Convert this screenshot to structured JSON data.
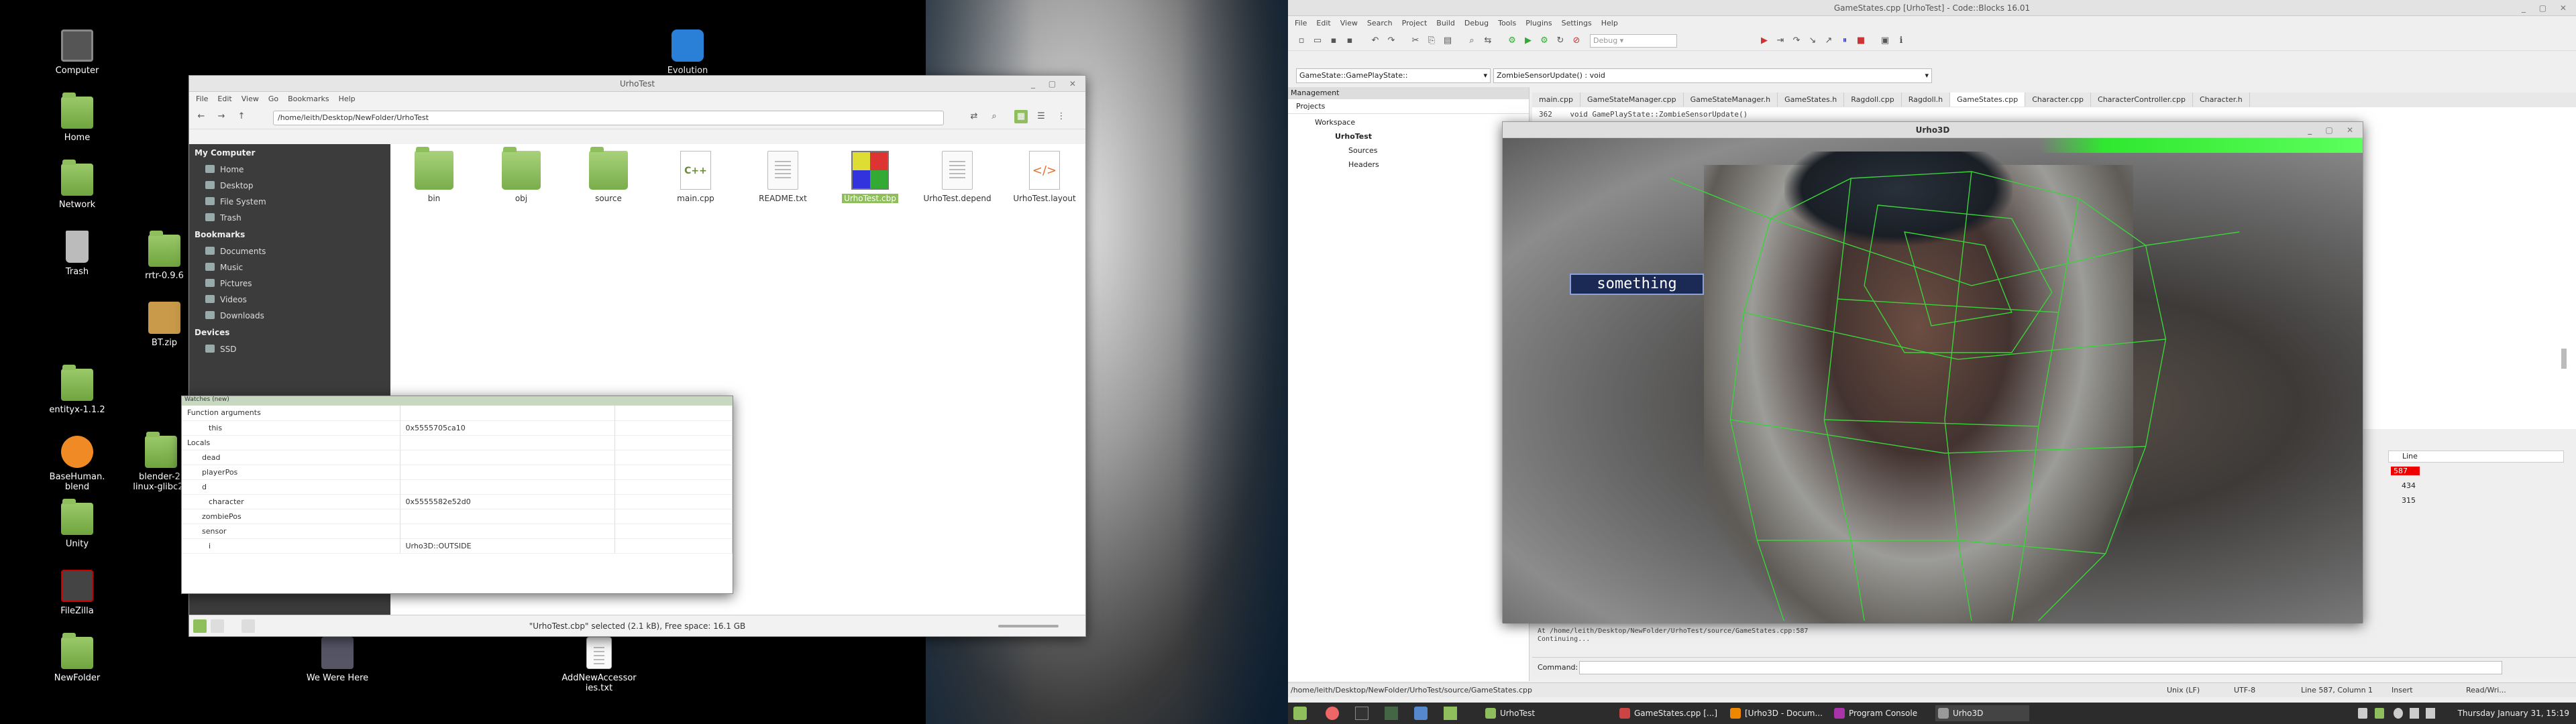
{
  "desktop": {
    "icons": [
      {
        "label": "Computer"
      },
      {
        "label": "Home"
      },
      {
        "label": "Network"
      },
      {
        "label": "Trash"
      },
      {
        "label": "rrtr-0.9.6"
      },
      {
        "label": "BT.zip"
      },
      {
        "label": "entityx-1.1.2"
      },
      {
        "label": "BaseHuman.\nblend"
      },
      {
        "label": "blender-2.\nlinux-glibc21"
      },
      {
        "label": "Unity"
      },
      {
        "label": "FileZilla"
      },
      {
        "label": "NewFolder"
      },
      {
        "label": "Evolution"
      },
      {
        "label": "We Were Here"
      },
      {
        "label": "AddNewAccessor\nies.txt"
      }
    ]
  },
  "nemo": {
    "title": "UrhoTest",
    "menu": [
      "File",
      "Edit",
      "View",
      "Go",
      "Bookmarks",
      "Help"
    ],
    "path": "/home/leith/Desktop/NewFolder/UrhoTest",
    "sidebar": {
      "computer_header": "My Computer",
      "computer_items": [
        "Home",
        "Desktop",
        "File System",
        "Trash"
      ],
      "bookmarks_header": "Bookmarks",
      "bookmark_items": [
        "Documents",
        "Music",
        "Pictures",
        "Videos",
        "Downloads"
      ],
      "devices_header": "Devices",
      "device_items": [
        "SSD"
      ]
    },
    "files": [
      "bin",
      "obj",
      "source",
      "main.cpp",
      "README.txt",
      "UrhoTest.cbp",
      "UrhoTest.depend",
      "UrhoTest.layout"
    ],
    "status": "\"UrhoTest.cbp\" selected (2.1 kB), Free space: 16.1 GB"
  },
  "watches": {
    "title": "Watches (new)",
    "rows": [
      {
        "name": "Function arguments",
        "value": ""
      },
      {
        "name": "this",
        "value": "0x5555705ca10"
      },
      {
        "name": "Locals",
        "value": ""
      },
      {
        "name": "dead",
        "value": ""
      },
      {
        "name": "playerPos",
        "value": ""
      },
      {
        "name": "d",
        "value": ""
      },
      {
        "name": "character",
        "value": "0x5555582e52d0"
      },
      {
        "name": "zombiePos",
        "value": ""
      },
      {
        "name": "sensor",
        "value": ""
      },
      {
        "name": "i",
        "value": "Urho3D::OUTSIDE"
      }
    ]
  },
  "codeblocks": {
    "title": "GameStates.cpp [UrhoTest] - Code::Blocks 16.01",
    "menu": [
      "File",
      "Edit",
      "View",
      "Search",
      "Project",
      "Build",
      "Debug",
      "Tools",
      "Plugins",
      "Settings",
      "Help"
    ],
    "build_target": "Debug",
    "scope_select": "GameState::GamePlayState::",
    "function_select": "ZombieSensorUpdate() : void",
    "management_label": "Management",
    "projects_tab": "Projects",
    "tree": [
      "Workspace",
      "UrhoTest",
      "Sources",
      "Headers"
    ],
    "tabs": [
      "main.cpp",
      "GameStateManager.cpp",
      "GameStateManager.h",
      "GameStates.h",
      "Ragdoll.cpp",
      "Ragdoll.h",
      "GameStates.cpp",
      "Character.cpp",
      "CharacterController.cpp",
      "Character.h"
    ],
    "code_line_no": "362",
    "code_line": "void GamePlayState::ZombieSensorUpdate()",
    "line_header": "Line",
    "line_values": [
      "587",
      "434",
      "315"
    ],
    "log_lines": [
      "At /home/leith/Desktop/NewFolder/UrhoTest/source/GameStates.cpp:587",
      "Continuing..."
    ],
    "command_label": "Command:",
    "status_path": "/home/leith/Desktop/NewFolder/UrhoTest/source/GameStates.cpp",
    "status_eol": "Unix (LF)",
    "status_enc": "UTF-8",
    "status_pos": "Line 587, Column 1",
    "status_mode": "Insert",
    "status_rw": "Read/Wri..."
  },
  "urho": {
    "title": "Urho3D",
    "hud_text": "something"
  },
  "taskbar": {
    "tasks": [
      "UrhoTest",
      "GameStates.cpp [...]",
      "[Urho3D - Docum...",
      "Program Console",
      "Urho3D"
    ],
    "clock": "Thursday January 31, 15:19"
  }
}
